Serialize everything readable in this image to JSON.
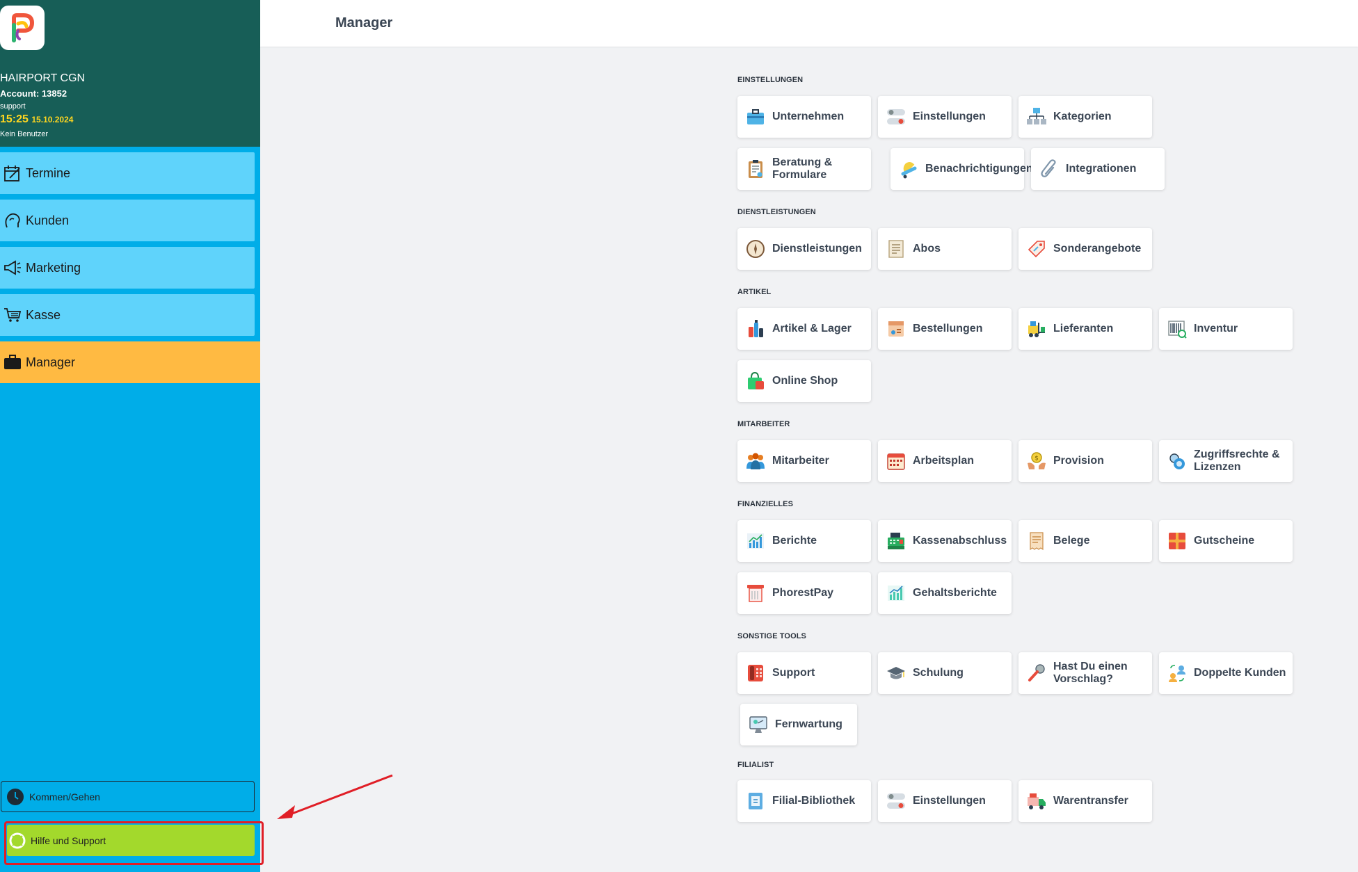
{
  "brand": {
    "company": "HAIRPORT CGN",
    "account": "Account: 13852",
    "user": "support",
    "time": "15:25",
    "date": "15.10.2024",
    "no_user": "Kein Benutzer"
  },
  "nav": {
    "termine": "Termine",
    "kunden": "Kunden",
    "marketing": "Marketing",
    "kasse": "Kasse",
    "manager": "Manager"
  },
  "sidebar_bottom": {
    "clock_label": "Kommen/Gehen",
    "help_label": "Hilfe und Support"
  },
  "header": {
    "title": "Manager"
  },
  "colors": {
    "sidebar": "#00ade8",
    "brand_bg": "#175e57",
    "nav_item": "#5fd3fb",
    "nav_active": "#ffba42",
    "help_button": "#a3d92c",
    "highlight": "#e01e26"
  },
  "sections": {
    "einstellungen": {
      "title": "EINSTELLUNGEN",
      "items": [
        "Unternehmen",
        "Einstellungen",
        "Kategorien",
        "Beratung & Formulare",
        "Benachrichtigungen",
        "Integrationen"
      ]
    },
    "dienstleistungen": {
      "title": "DIENSTLEISTUNGEN",
      "items": [
        "Dienstleistungen",
        "Abos",
        "Sonderangebote"
      ]
    },
    "artikel": {
      "title": "ARTIKEL",
      "items": [
        "Artikel & Lager",
        "Bestellungen",
        "Lieferanten",
        "Inventur",
        "Online Shop"
      ]
    },
    "mitarbeiter": {
      "title": "MITARBEITER",
      "items": [
        "Mitarbeiter",
        "Arbeitsplan",
        "Provision",
        "Zugriffsrechte & Lizenzen"
      ]
    },
    "finanzielles": {
      "title": "FINANZIELLES",
      "items": [
        "Berichte",
        "Kassenabschluss",
        "Belege",
        "Gutscheine",
        "PhorestPay",
        "Gehaltsberichte"
      ]
    },
    "sonstige": {
      "title": "SONSTIGE TOOLS",
      "items": [
        "Support",
        "Schulung",
        "Hast Du einen Vorschlag?",
        "Doppelte Kunden",
        "Fernwartung"
      ]
    },
    "filialist": {
      "title": "FILIALIST",
      "items": [
        "Filial-Bibliothek",
        "Einstellungen",
        "Warentransfer"
      ]
    }
  }
}
